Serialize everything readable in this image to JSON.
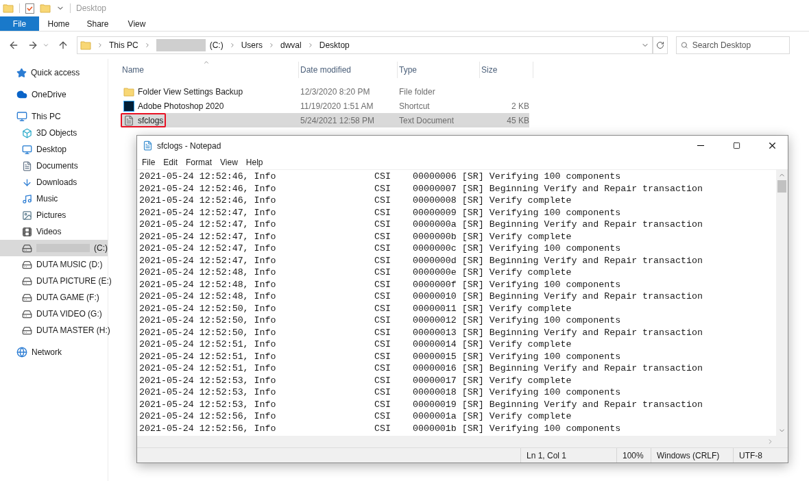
{
  "explorer": {
    "title": "Desktop",
    "ribbon_tabs": [
      {
        "label": "File",
        "selected": true
      },
      {
        "label": "Home",
        "selected": false
      },
      {
        "label": "Share",
        "selected": false
      },
      {
        "label": "View",
        "selected": false
      }
    ],
    "breadcrumb": [
      {
        "label": "This PC",
        "redacted": false
      },
      {
        "label": "(C:)",
        "redacted": true
      },
      {
        "label": "Users",
        "redacted": false
      },
      {
        "label": "dwval",
        "redacted": false
      },
      {
        "label": "Desktop",
        "redacted": false
      }
    ],
    "search": {
      "placeholder": "Search Desktop"
    },
    "sidebar": {
      "items": [
        {
          "label": "Quick access",
          "kind": "star",
          "selected": false,
          "redacted": false
        },
        {
          "label": "OneDrive",
          "kind": "cloud",
          "selected": false,
          "redacted": false
        },
        {
          "label": "This PC",
          "kind": "pc",
          "selected": false,
          "redacted": false,
          "children": [
            {
              "label": "3D Objects",
              "kind": "cube",
              "selected": false,
              "redacted": false
            },
            {
              "label": "Desktop",
              "kind": "desktop",
              "selected": false,
              "redacted": false
            },
            {
              "label": "Documents",
              "kind": "document",
              "selected": false,
              "redacted": false
            },
            {
              "label": "Downloads",
              "kind": "download",
              "selected": false,
              "redacted": false
            },
            {
              "label": "Music",
              "kind": "music",
              "selected": false,
              "redacted": false
            },
            {
              "label": "Pictures",
              "kind": "picture",
              "selected": false,
              "redacted": false
            },
            {
              "label": "Videos",
              "kind": "video",
              "selected": false,
              "redacted": false
            },
            {
              "label": "(C:)",
              "kind": "drive",
              "selected": true,
              "redacted": true
            },
            {
              "label": "DUTA MUSIC (D:)",
              "kind": "drive",
              "selected": false,
              "redacted": false
            },
            {
              "label": "DUTA PICTURE (E:)",
              "kind": "drive",
              "selected": false,
              "redacted": false
            },
            {
              "label": "DUTA GAME (F:)",
              "kind": "drive",
              "selected": false,
              "redacted": false
            },
            {
              "label": "DUTA VIDEO (G:)",
              "kind": "drive",
              "selected": false,
              "redacted": false
            },
            {
              "label": "DUTA MASTER (H:)",
              "kind": "drive",
              "selected": false,
              "redacted": false
            }
          ]
        },
        {
          "label": "Network",
          "kind": "network",
          "selected": false,
          "redacted": false
        }
      ]
    },
    "table": {
      "columns": [
        "Name",
        "Date modified",
        "Type",
        "Size"
      ],
      "rows": [
        {
          "name": "Folder View Settings Backup",
          "kind": "folder",
          "date": "12/3/2020 8:20 PM",
          "type": "File folder",
          "size": "",
          "selected": false,
          "outlined": false
        },
        {
          "name": "Adobe Photoshop 2020",
          "kind": "shortcut",
          "date": "11/19/2020 1:51 AM",
          "type": "Shortcut",
          "size": "2 KB",
          "selected": false,
          "outlined": false
        },
        {
          "name": "sfclogs",
          "kind": "text",
          "date": "5/24/2021 12:58 PM",
          "type": "Text Document",
          "size": "45 KB",
          "selected": true,
          "outlined": true
        }
      ]
    }
  },
  "notepad": {
    "title": "sfclogs - Notepad",
    "menu": [
      "File",
      "Edit",
      "Format",
      "View",
      "Help"
    ],
    "lines": [
      "2021-05-24 12:52:46, Info                  CSI    00000006 [SR] Verifying 100 components",
      "2021-05-24 12:52:46, Info                  CSI    00000007 [SR] Beginning Verify and Repair transaction",
      "2021-05-24 12:52:46, Info                  CSI    00000008 [SR] Verify complete",
      "2021-05-24 12:52:47, Info                  CSI    00000009 [SR] Verifying 100 components",
      "2021-05-24 12:52:47, Info                  CSI    0000000a [SR] Beginning Verify and Repair transaction",
      "2021-05-24 12:52:47, Info                  CSI    0000000b [SR] Verify complete",
      "2021-05-24 12:52:47, Info                  CSI    0000000c [SR] Verifying 100 components",
      "2021-05-24 12:52:47, Info                  CSI    0000000d [SR] Beginning Verify and Repair transaction",
      "2021-05-24 12:52:48, Info                  CSI    0000000e [SR] Verify complete",
      "2021-05-24 12:52:48, Info                  CSI    0000000f [SR] Verifying 100 components",
      "2021-05-24 12:52:48, Info                  CSI    00000010 [SR] Beginning Verify and Repair transaction",
      "2021-05-24 12:52:50, Info                  CSI    00000011 [SR] Verify complete",
      "2021-05-24 12:52:50, Info                  CSI    00000012 [SR] Verifying 100 components",
      "2021-05-24 12:52:50, Info                  CSI    00000013 [SR] Beginning Verify and Repair transaction",
      "2021-05-24 12:52:51, Info                  CSI    00000014 [SR] Verify complete",
      "2021-05-24 12:52:51, Info                  CSI    00000015 [SR] Verifying 100 components",
      "2021-05-24 12:52:51, Info                  CSI    00000016 [SR] Beginning Verify and Repair transaction",
      "2021-05-24 12:52:53, Info                  CSI    00000017 [SR] Verify complete",
      "2021-05-24 12:52:53, Info                  CSI    00000018 [SR] Verifying 100 components",
      "2021-05-24 12:52:53, Info                  CSI    00000019 [SR] Beginning Verify and Repair transaction",
      "2021-05-24 12:52:56, Info                  CSI    0000001a [SR] Verify complete",
      "2021-05-24 12:52:56, Info                  CSI    0000001b [SR] Verifying 100 components"
    ],
    "status_bar": [
      "Ln 1, Col 1",
      "100%",
      "Windows (CRLF)",
      "UTF-8"
    ]
  }
}
